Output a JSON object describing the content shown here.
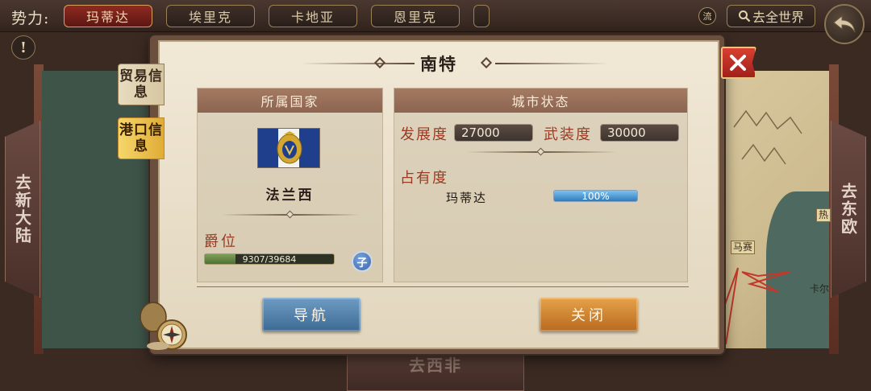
{
  "topbar": {
    "faction_label": "势力:",
    "factions": [
      "玛蒂达",
      "埃里克",
      "卡地亚",
      "恩里克"
    ],
    "active_index": 0,
    "flow_label": "流",
    "world_button": "去全世界"
  },
  "nav": {
    "left": "去新大陆",
    "right": "去东欧",
    "bottom": "去西非"
  },
  "map": {
    "labels": [
      "热",
      "马赛",
      "卡尔"
    ]
  },
  "dialog": {
    "title": "南特",
    "tabs": {
      "trade": "贸易信息",
      "port": "港口信息"
    },
    "country": {
      "header": "所属国家",
      "name": "法兰西",
      "rank_label": "爵位",
      "rank_progress_text": "9307/39684",
      "rank_progress_value": 9307,
      "rank_progress_max": 39684,
      "rank_badge": "子"
    },
    "status": {
      "header": "城市状态",
      "development_label": "发展度",
      "development_value": "27000",
      "military_label": "武装度",
      "military_value": "30000",
      "occupancy_label": "占有度",
      "occupant_name": "玛蒂达",
      "occupancy_text": "100%",
      "occupancy_fraction": 1.0
    },
    "buttons": {
      "navigate": "导航",
      "close": "关闭"
    }
  },
  "colors": {
    "accent_red": "#9a3a22",
    "tab_active": "#e0ac36",
    "nav_button": "#3c6a92",
    "close_button": "#b86a1e"
  }
}
